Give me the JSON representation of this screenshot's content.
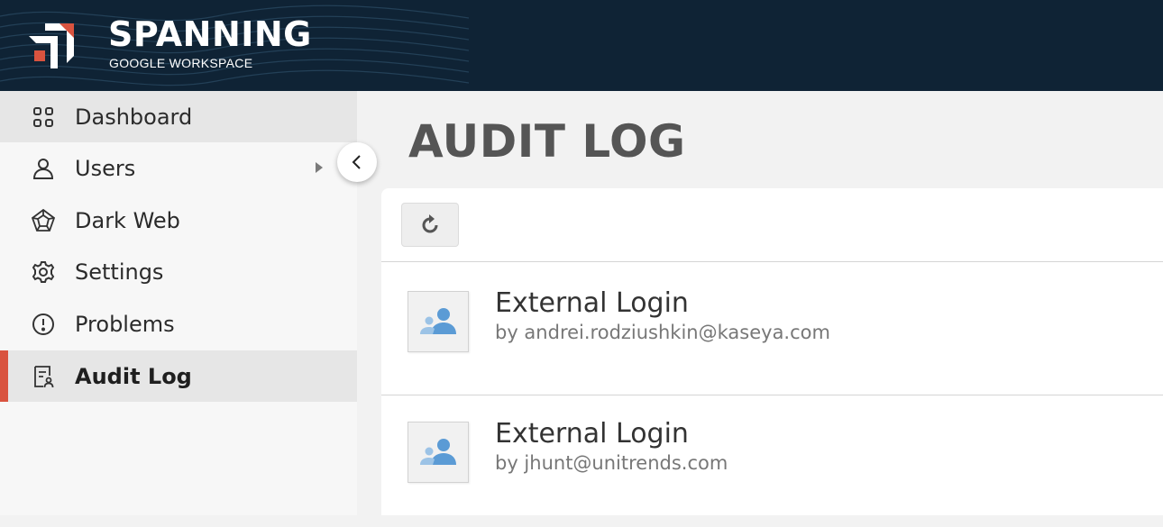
{
  "header": {
    "brand": "SPANNING",
    "product": "GOOGLE WORKSPACE",
    "colors": {
      "background": "#0f2335",
      "accent": "#d9533f"
    }
  },
  "sidebar": {
    "items": [
      {
        "label": "Dashboard",
        "icon": "grid-icon"
      },
      {
        "label": "Users",
        "icon": "user-icon",
        "has_submenu": true
      },
      {
        "label": "Dark Web",
        "icon": "dark-web-icon"
      },
      {
        "label": "Settings",
        "icon": "gear-icon"
      },
      {
        "label": "Problems",
        "icon": "alert-circle-icon"
      },
      {
        "label": "Audit Log",
        "icon": "audit-log-icon",
        "active": true
      }
    ],
    "collapse_icon": "chevron-left-icon"
  },
  "main": {
    "title": "AUDIT LOG",
    "refresh_icon": "refresh-icon",
    "entries": [
      {
        "title": "External Login",
        "subtitle": "by andrei.rodziushkin@kaseya.com",
        "icon": "user-group-icon"
      },
      {
        "title": "External Login",
        "subtitle": "by jhunt@unitrends.com",
        "icon": "user-group-icon"
      }
    ]
  }
}
